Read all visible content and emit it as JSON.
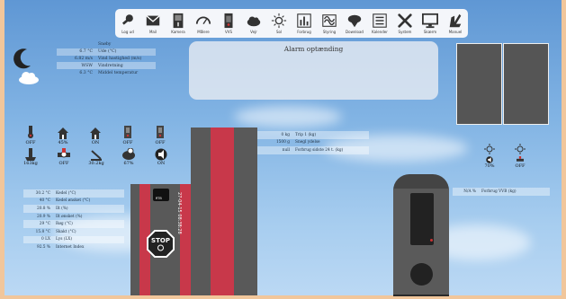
{
  "toolbar": {
    "items": [
      {
        "label": "Log ud",
        "icon": "key-icon"
      },
      {
        "label": "Mail",
        "icon": "mail-icon"
      },
      {
        "label": "Kamera",
        "icon": "fridge-icon"
      },
      {
        "label": "Målere",
        "icon": "gauge-icon"
      },
      {
        "label": "VVS",
        "icon": "boiler-icon"
      },
      {
        "label": "Vejr",
        "icon": "cloud-icon"
      },
      {
        "label": "Sol",
        "icon": "sun-icon"
      },
      {
        "label": "Forbrug",
        "icon": "chart-icon"
      },
      {
        "label": "Styring",
        "icon": "heatpump-icon"
      },
      {
        "label": "Download",
        "icon": "download-icon"
      },
      {
        "label": "Kalender",
        "icon": "list-icon"
      },
      {
        "label": "System",
        "icon": "tools-icon"
      },
      {
        "label": "Skærm",
        "icon": "monitor-icon"
      },
      {
        "label": "Manuel",
        "icon": "manual-icon"
      }
    ]
  },
  "weather": {
    "location": "Snøby",
    "rows": [
      {
        "value": "6.7 °C",
        "label": "Ude (°C)"
      },
      {
        "value": "6.82 m/s",
        "label": "Vind hastighed (m/s)"
      },
      {
        "value": "WSW",
        "label": "Vindretning"
      },
      {
        "value": "6.3 °C",
        "label": "Middel temperatur"
      }
    ]
  },
  "alarm": {
    "title": "Alarm optænding"
  },
  "devices_top": [
    {
      "state": "OFF",
      "icon": "thermometer-icon"
    },
    {
      "state": "45%",
      "icon": "house-icon"
    },
    {
      "state": "ON",
      "icon": "house-icon"
    },
    {
      "state": "OFF",
      "icon": "boiler-icon"
    },
    {
      "state": "OFF",
      "icon": "boiler-icon"
    }
  ],
  "devices_bottom": [
    {
      "state": "163kg",
      "icon": "silo-icon"
    },
    {
      "state": "OFF",
      "icon": "pump-icon"
    },
    {
      "state": "30.2kg",
      "icon": "scale-icon"
    },
    {
      "state": "67%",
      "icon": "tank-icon"
    },
    {
      "state": "ON",
      "icon": "speaker-icon"
    }
  ],
  "devices_right": [
    {
      "state": "70%",
      "icon": "sun-icon"
    },
    {
      "state": "OFF",
      "icon": "sun-icon"
    }
  ],
  "fuel": {
    "rows": [
      {
        "value": "0 kg",
        "label": "Trip 1 (kg)"
      },
      {
        "value": "1500 g",
        "label": "Snegl ydelse"
      },
      {
        "value": "null",
        "label": "Forbrug sidste 24 t. (kg)"
      }
    ]
  },
  "boiler": {
    "rows": [
      {
        "value": "30.2 °C",
        "label": "Kedel (°C)"
      },
      {
        "value": "40 °C",
        "label": "Kedel ønsket (°C)"
      },
      {
        "value": "20.8 %",
        "label": "Ilt (%)"
      },
      {
        "value": "20.9 %",
        "label": "Ilt ønsket (%)"
      },
      {
        "value": "29 °C",
        "label": "Røg (°C)"
      },
      {
        "value": "15.8 °C",
        "label": "Skakt (°C)"
      },
      {
        "value": "0 LX",
        "label": "Lys (LX)"
      },
      {
        "value": "92.5 %",
        "label": "Internet Index"
      }
    ]
  },
  "vvb": {
    "value": "N/A %",
    "label": "Forbrug VVB (kg)"
  },
  "stove": {
    "timestamp": "27-04-15 08:38:28",
    "stop_label": "STOP",
    "rtb_label": "RTB"
  },
  "colors": {
    "accent_red": "#c8384a",
    "frame": "#f1c69b",
    "panel": "#595959"
  }
}
